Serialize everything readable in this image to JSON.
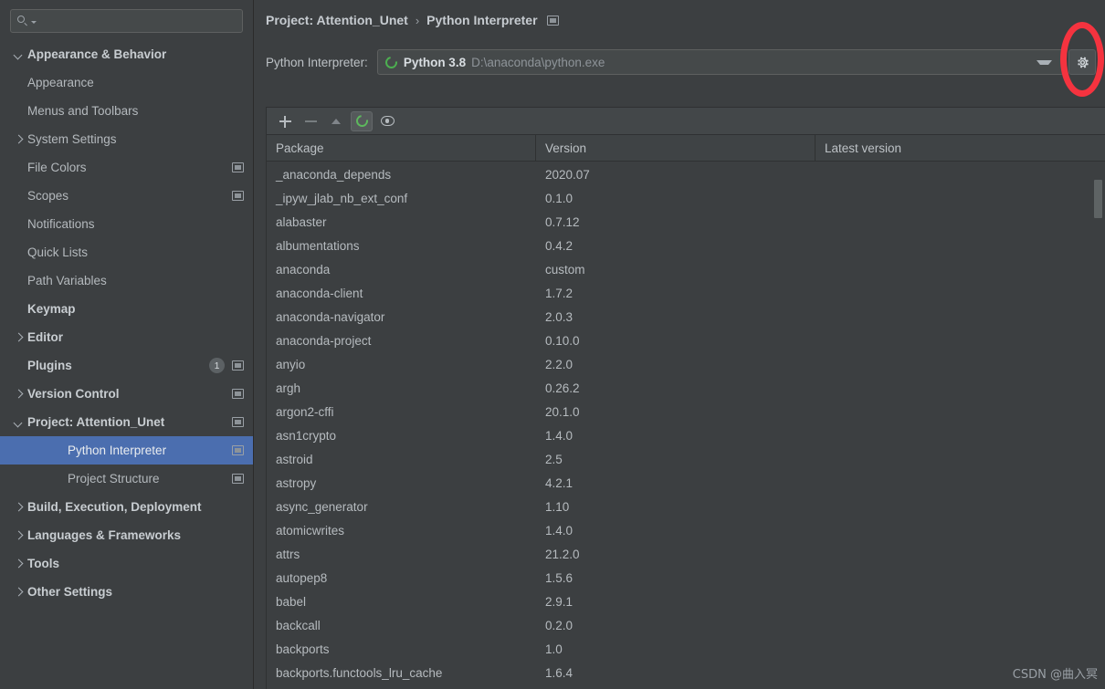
{
  "search": {
    "value": "",
    "placeholder": "",
    "icon": "search-icon"
  },
  "sidebar": {
    "items": [
      {
        "label": "Appearance & Behavior",
        "level": 0,
        "arrow": "expanded",
        "bold": true,
        "icon": null,
        "badge": null,
        "selected": false
      },
      {
        "label": "Appearance",
        "level": 1,
        "arrow": "none",
        "bold": false,
        "icon": null,
        "badge": null,
        "selected": false
      },
      {
        "label": "Menus and Toolbars",
        "level": 1,
        "arrow": "none",
        "bold": false,
        "icon": null,
        "badge": null,
        "selected": false
      },
      {
        "label": "System Settings",
        "level": 1,
        "arrow": "collapsed",
        "bold": false,
        "icon": null,
        "badge": null,
        "selected": false
      },
      {
        "label": "File Colors",
        "level": 1,
        "arrow": "none",
        "bold": false,
        "icon": "project-scope-icon",
        "badge": null,
        "selected": false
      },
      {
        "label": "Scopes",
        "level": 1,
        "arrow": "none",
        "bold": false,
        "icon": "project-scope-icon",
        "badge": null,
        "selected": false
      },
      {
        "label": "Notifications",
        "level": 1,
        "arrow": "none",
        "bold": false,
        "icon": null,
        "badge": null,
        "selected": false
      },
      {
        "label": "Quick Lists",
        "level": 1,
        "arrow": "none",
        "bold": false,
        "icon": null,
        "badge": null,
        "selected": false
      },
      {
        "label": "Path Variables",
        "level": 1,
        "arrow": "none",
        "bold": false,
        "icon": null,
        "badge": null,
        "selected": false
      },
      {
        "label": "Keymap",
        "level": 0,
        "arrow": "none",
        "bold": true,
        "icon": null,
        "badge": null,
        "selected": false
      },
      {
        "label": "Editor",
        "level": 0,
        "arrow": "collapsed",
        "bold": true,
        "icon": null,
        "badge": null,
        "selected": false
      },
      {
        "label": "Plugins",
        "level": 0,
        "arrow": "none",
        "bold": true,
        "icon": "project-scope-icon",
        "badge": "1",
        "selected": false
      },
      {
        "label": "Version Control",
        "level": 0,
        "arrow": "collapsed",
        "bold": true,
        "icon": "project-scope-icon",
        "badge": null,
        "selected": false
      },
      {
        "label": "Project: Attention_Unet",
        "level": 0,
        "arrow": "expanded",
        "bold": true,
        "icon": "project-scope-icon",
        "badge": null,
        "selected": false
      },
      {
        "label": "Python Interpreter",
        "level": 2,
        "arrow": "none",
        "bold": false,
        "icon": "project-scope-icon",
        "badge": null,
        "selected": true
      },
      {
        "label": "Project Structure",
        "level": 2,
        "arrow": "none",
        "bold": false,
        "icon": "project-scope-icon",
        "badge": null,
        "selected": false
      },
      {
        "label": "Build, Execution, Deployment",
        "level": 0,
        "arrow": "collapsed",
        "bold": true,
        "icon": null,
        "badge": null,
        "selected": false
      },
      {
        "label": "Languages & Frameworks",
        "level": 0,
        "arrow": "collapsed",
        "bold": true,
        "icon": null,
        "badge": null,
        "selected": false
      },
      {
        "label": "Tools",
        "level": 0,
        "arrow": "collapsed",
        "bold": true,
        "icon": null,
        "badge": null,
        "selected": false
      },
      {
        "label": "Other Settings",
        "level": 0,
        "arrow": "collapsed",
        "bold": true,
        "icon": null,
        "badge": null,
        "selected": false
      }
    ]
  },
  "header": {
    "breadcrumb": [
      "Project: Attention_Unet",
      "Python Interpreter"
    ],
    "separator": "›",
    "settings_icon": "project-scope-icon"
  },
  "interpreter": {
    "label": "Python Interpreter:",
    "name": "Python 3.8",
    "path": "D:\\anaconda\\python.exe",
    "status_icon": "conda-env-icon",
    "dropdown_icon": "chevron-down-icon",
    "gear_icon": "gear-icon"
  },
  "packages_toolbar": {
    "buttons": [
      {
        "name": "add-package-button",
        "icon": "plus-icon",
        "enabled": true,
        "active": false
      },
      {
        "name": "remove-package-button",
        "icon": "minus-icon",
        "enabled": false,
        "active": false
      },
      {
        "name": "upgrade-package-button",
        "icon": "arrow-up-icon",
        "enabled": false,
        "active": false
      },
      {
        "name": "conda-packages-button",
        "icon": "conda-icon",
        "enabled": true,
        "active": true
      },
      {
        "name": "show-early-releases-button",
        "icon": "eye-icon",
        "enabled": true,
        "active": false
      }
    ]
  },
  "packages_table": {
    "columns": [
      "Package",
      "Version",
      "Latest version"
    ],
    "rows": [
      {
        "package": "_anaconda_depends",
        "version": "2020.07",
        "latest": ""
      },
      {
        "package": "_ipyw_jlab_nb_ext_conf",
        "version": "0.1.0",
        "latest": ""
      },
      {
        "package": "alabaster",
        "version": "0.7.12",
        "latest": ""
      },
      {
        "package": "albumentations",
        "version": "0.4.2",
        "latest": ""
      },
      {
        "package": "anaconda",
        "version": "custom",
        "latest": ""
      },
      {
        "package": "anaconda-client",
        "version": "1.7.2",
        "latest": ""
      },
      {
        "package": "anaconda-navigator",
        "version": "2.0.3",
        "latest": ""
      },
      {
        "package": "anaconda-project",
        "version": "0.10.0",
        "latest": ""
      },
      {
        "package": "anyio",
        "version": "2.2.0",
        "latest": ""
      },
      {
        "package": "argh",
        "version": "0.26.2",
        "latest": ""
      },
      {
        "package": "argon2-cffi",
        "version": "20.1.0",
        "latest": ""
      },
      {
        "package": "asn1crypto",
        "version": "1.4.0",
        "latest": ""
      },
      {
        "package": "astroid",
        "version": "2.5",
        "latest": ""
      },
      {
        "package": "astropy",
        "version": "4.2.1",
        "latest": ""
      },
      {
        "package": "async_generator",
        "version": "1.10",
        "latest": ""
      },
      {
        "package": "atomicwrites",
        "version": "1.4.0",
        "latest": ""
      },
      {
        "package": "attrs",
        "version": "21.2.0",
        "latest": ""
      },
      {
        "package": "autopep8",
        "version": "1.5.6",
        "latest": ""
      },
      {
        "package": "babel",
        "version": "2.9.1",
        "latest": ""
      },
      {
        "package": "backcall",
        "version": "0.2.0",
        "latest": ""
      },
      {
        "package": "backports",
        "version": "1.0",
        "latest": ""
      },
      {
        "package": "backports.functools_lru_cache",
        "version": "1.6.4",
        "latest": ""
      }
    ]
  },
  "annotation": {
    "shape": "ellipse",
    "color": "#f5333f",
    "target": "gear-button"
  },
  "watermark": {
    "text": "CSDN @曲入冥"
  },
  "colors": {
    "panel_bg": "#3c3f41",
    "selection_blue": "#4b6eaf",
    "text": "#b6bbbf",
    "accent_green": "#5db85d",
    "annotation_red": "#f5333f"
  }
}
